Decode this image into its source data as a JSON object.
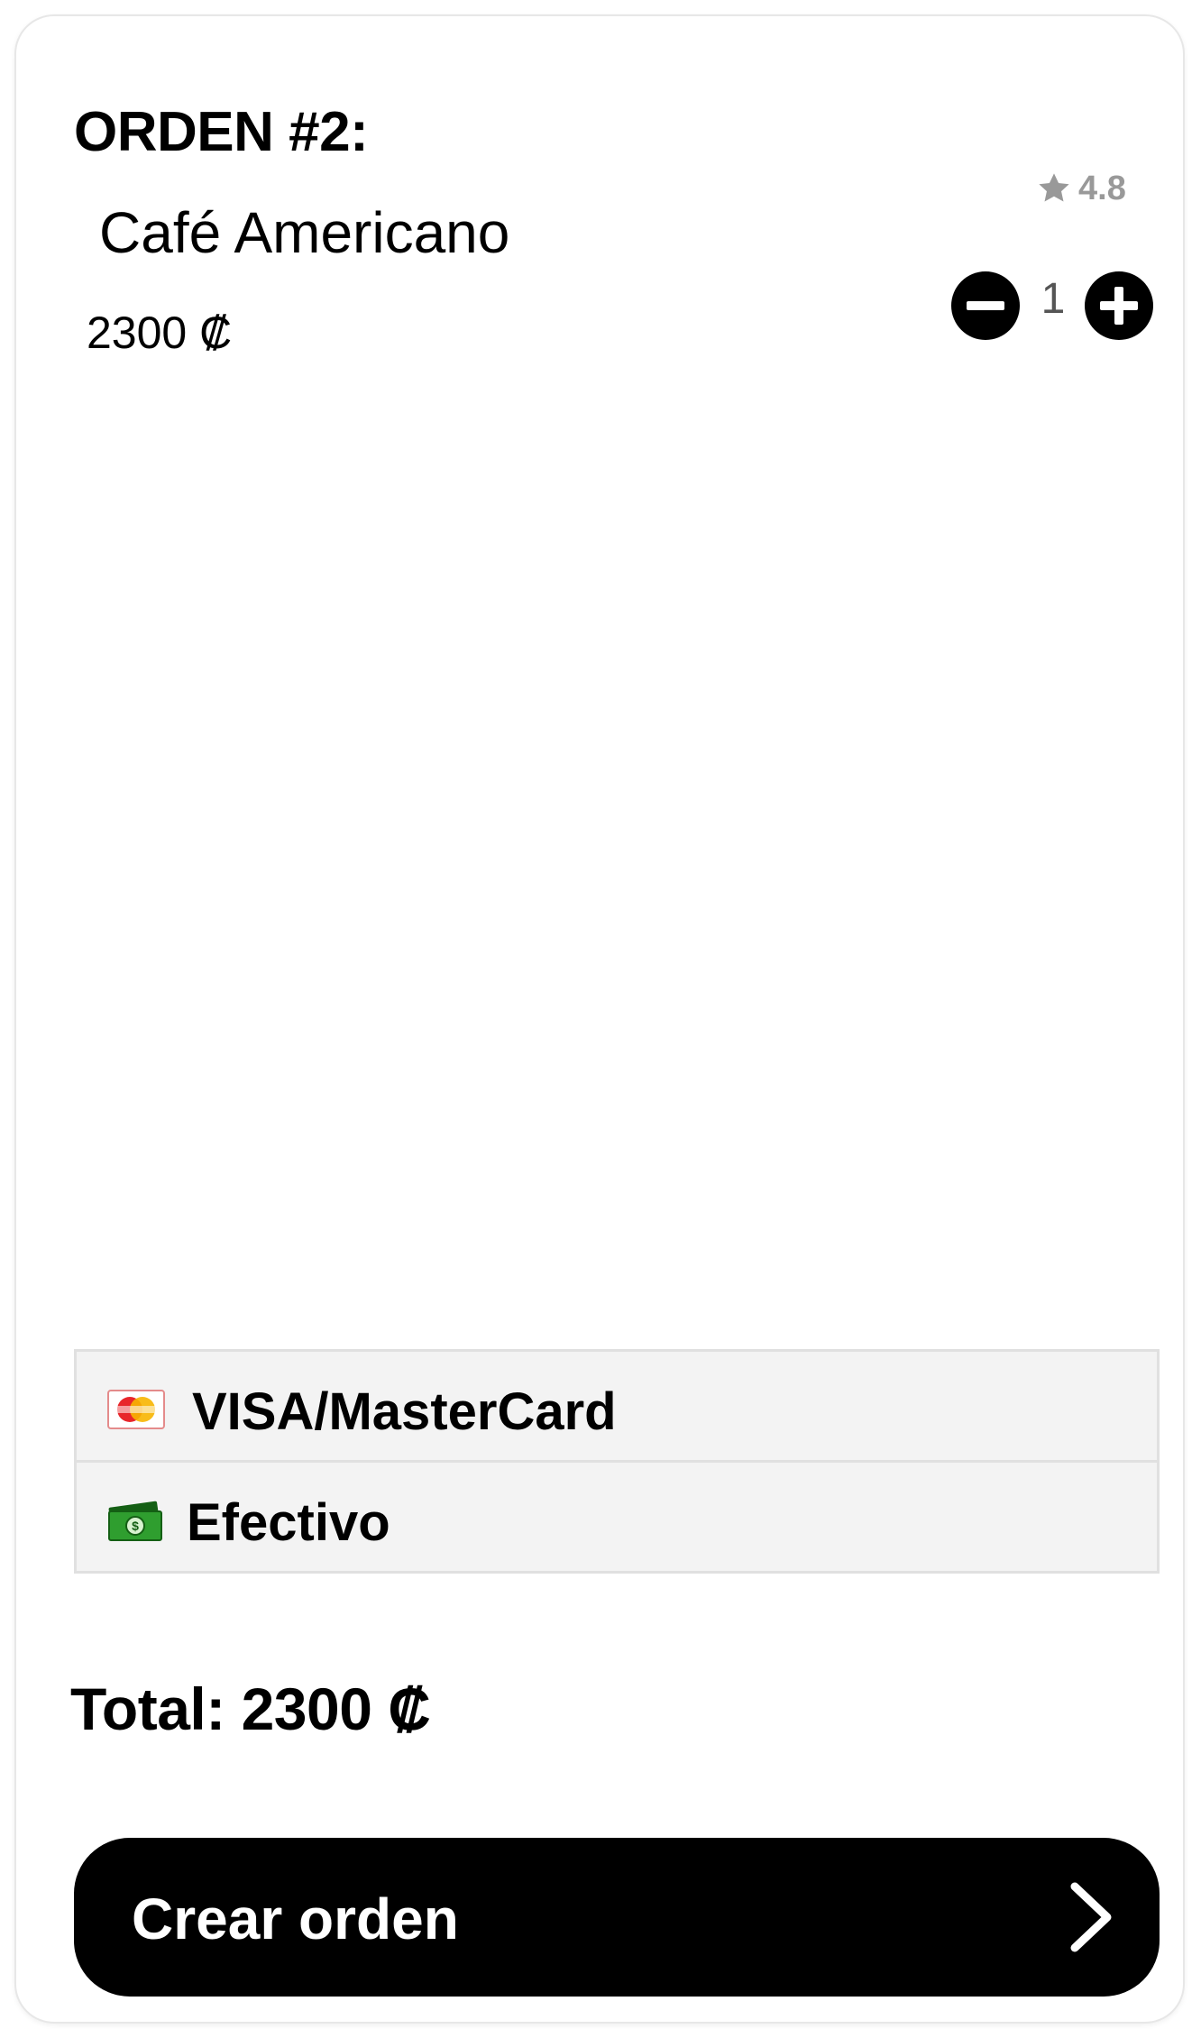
{
  "order": {
    "title": "ORDEN #2:"
  },
  "item": {
    "name": "Café Americano",
    "price": "2300 ₡",
    "rating": "4.8",
    "quantity": "1",
    "icons": {
      "rating": "star-icon",
      "decrease": "minus-circle-icon",
      "increase": "plus-circle-icon"
    }
  },
  "payment": {
    "options": [
      {
        "label": "VISA/MasterCard",
        "icon": "mastercard-icon"
      },
      {
        "label": "Efectivo",
        "icon": "cash-icon"
      }
    ]
  },
  "total": {
    "text": "Total: 2300 ₡"
  },
  "submit": {
    "label": "Crear orden",
    "icon": "chevron-right-icon"
  },
  "colors": {
    "primary": "#000000",
    "rating": "#999999",
    "payment_bg": "#f3f3f3",
    "cash_green": "#1f8a1f"
  }
}
